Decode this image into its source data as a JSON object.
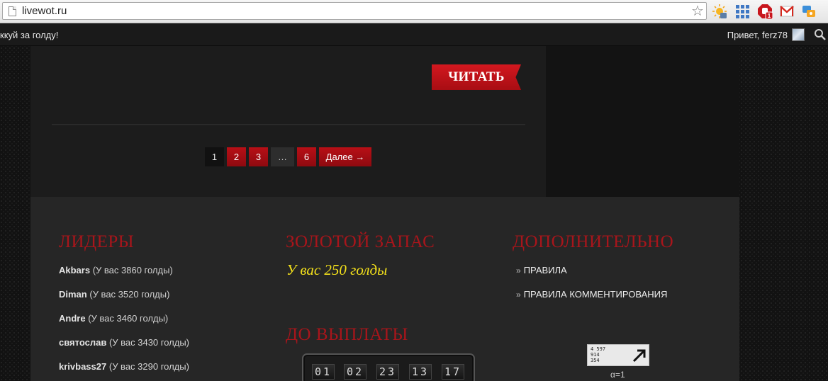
{
  "browser": {
    "url": "livewot.ru"
  },
  "topbar": {
    "ticker": "ккуй за голду!",
    "greeting": "Привет, ferz78"
  },
  "content": {
    "read_button": "ЧИТАТЬ",
    "pagination": {
      "pages": [
        "1",
        "2",
        "3",
        "…",
        "6"
      ],
      "current": "1",
      "next": "Далее →"
    }
  },
  "footer": {
    "leaders_title": "ЛИДЕРЫ",
    "leaders": [
      {
        "name": "Akbars",
        "gold": "(У вас 3860 голды)"
      },
      {
        "name": "Diman",
        "gold": "(У вас 3520 голды)"
      },
      {
        "name": "Andre",
        "gold": "(У вас 3460 голды)"
      },
      {
        "name": "святослав",
        "gold": "(У вас 3430 голды)"
      },
      {
        "name": "krivbass27",
        "gold": "(У вас 3290 голды)"
      }
    ],
    "gold_title": "ЗОЛОТОЙ ЗАПАС",
    "gold_text": "У вас 250 голды",
    "payout_title": "ДО ВЫПЛАТЫ",
    "countdown": [
      "01",
      "02",
      "23",
      "13",
      "17"
    ],
    "extra_title": "ДОПОЛНИТЕЛЬНО",
    "extra_links": [
      "ПРАВИЛА",
      "ПРАВИЛА КОММЕНТИРОВАНИЯ"
    ],
    "counter": {
      "numbers": [
        "4 597",
        "914",
        "354"
      ],
      "caption": "α=1"
    }
  },
  "colors": {
    "accent_red": "#b80f16",
    "title_red": "#a8151b",
    "gold_yellow": "#f4e11b"
  }
}
